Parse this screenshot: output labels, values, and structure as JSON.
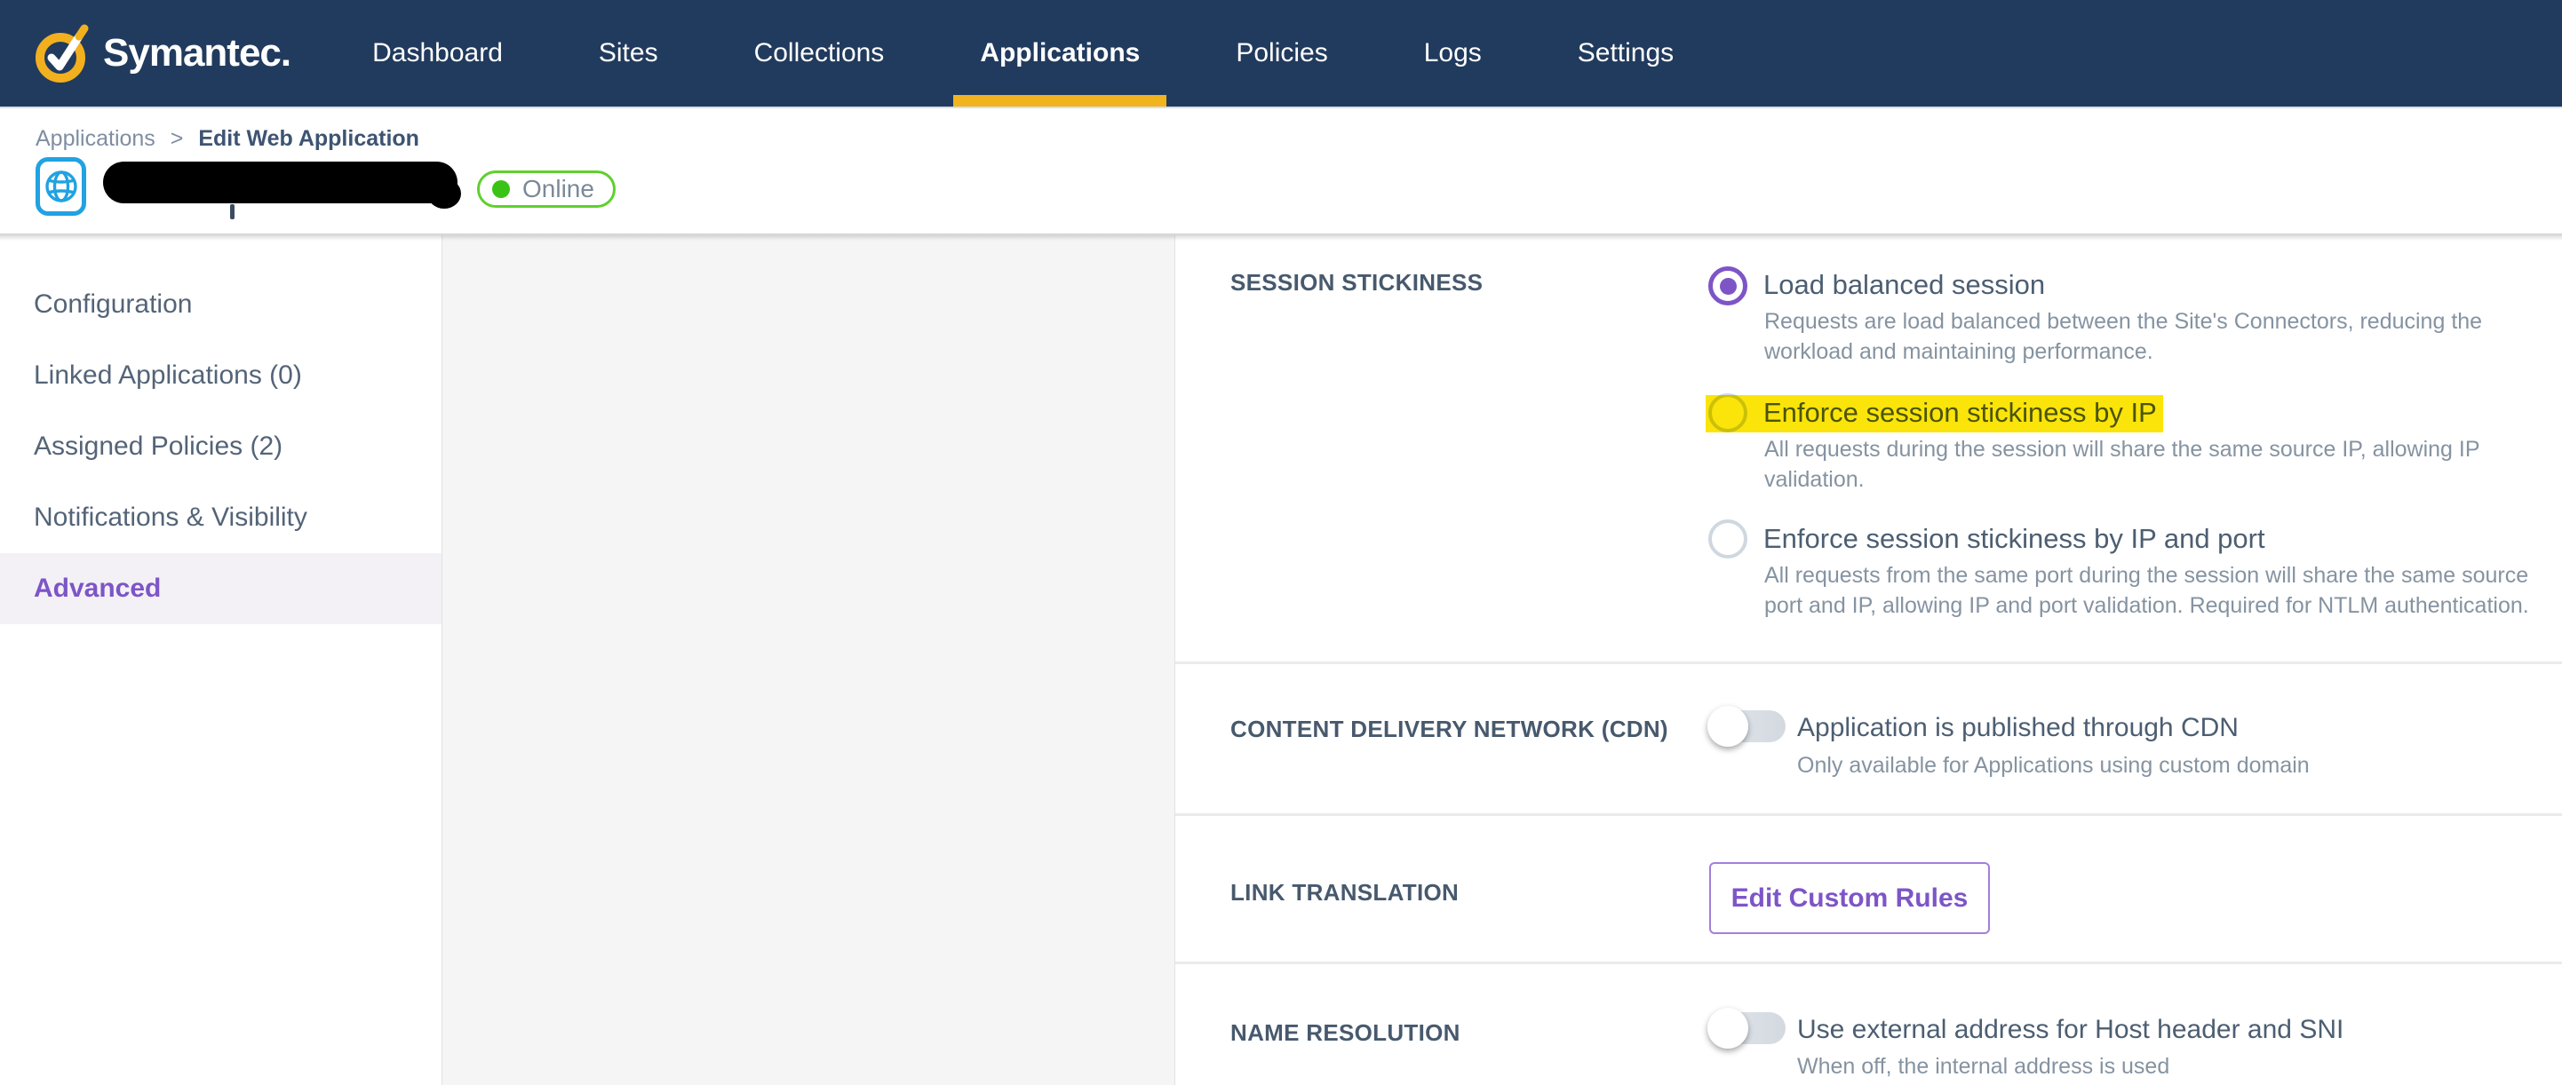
{
  "nav": {
    "brand": "Symantec.",
    "items": [
      {
        "label": "Dashboard",
        "active": false
      },
      {
        "label": "Sites",
        "active": false
      },
      {
        "label": "Collections",
        "active": false
      },
      {
        "label": "Applications",
        "active": true
      },
      {
        "label": "Policies",
        "active": false
      },
      {
        "label": "Logs",
        "active": false
      },
      {
        "label": "Settings",
        "active": false
      }
    ]
  },
  "breadcrumb": {
    "parent": "Applications",
    "separator": ">",
    "current": "Edit Web Application"
  },
  "app_header": {
    "name_redacted": true,
    "status_label": "Online"
  },
  "sidebar": {
    "items": [
      {
        "label": "Configuration",
        "active": false
      },
      {
        "label": "Linked Applications (0)",
        "active": false
      },
      {
        "label": "Assigned Policies (2)",
        "active": false
      },
      {
        "label": "Notifications & Visibility",
        "active": false
      },
      {
        "label": "Advanced",
        "active": true
      }
    ]
  },
  "sections": {
    "session_stickiness": {
      "label": "SESSION STICKINESS",
      "options": [
        {
          "label": "Load balanced session",
          "description": "Requests are load balanced between the Site's Connectors, reducing the workload and maintaining performance.",
          "selected": true,
          "highlighted": false
        },
        {
          "label": "Enforce session stickiness by IP",
          "description": "All requests during the session will share the same source IP, allowing IP validation.",
          "selected": false,
          "highlighted": true
        },
        {
          "label": "Enforce session stickiness by IP and port",
          "description": "All requests from the same port during the session will share the same source port and IP, allowing IP and port validation. Required for NTLM authentication.",
          "selected": false,
          "highlighted": false
        }
      ]
    },
    "cdn": {
      "label": "CONTENT DELIVERY NETWORK (CDN)",
      "toggle_label": "Application is published through CDN",
      "toggle_sublabel": "Only available for Applications using custom domain",
      "toggle_on": false
    },
    "link_translation": {
      "label": "LINK TRANSLATION",
      "button_label": "Edit Custom Rules"
    },
    "name_resolution": {
      "label": "NAME RESOLUTION",
      "toggle_label": "Use external address for Host header and SNI",
      "toggle_sublabel": "When off, the internal address is used",
      "toggle_on": false
    }
  },
  "colors": {
    "navbar_bg": "#213b5e",
    "accent_yellow": "#f1b41e",
    "active_purple": "#7d55c7",
    "online_green": "#3ac316",
    "highlight_yellow": "#fbe40a",
    "app_icon_blue": "#21a2e2"
  }
}
